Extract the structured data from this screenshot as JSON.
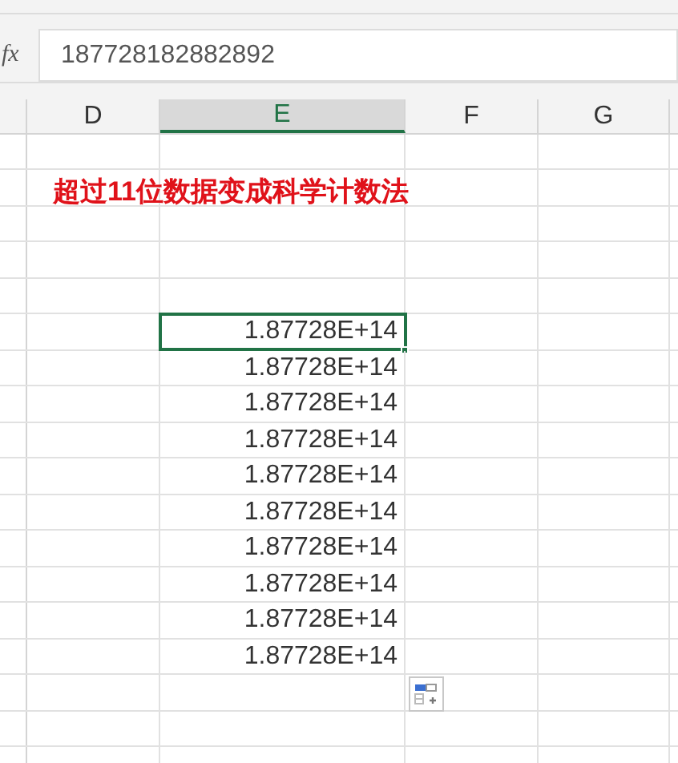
{
  "formula_bar": {
    "function_label": "fx",
    "value": "187728182882892"
  },
  "columns": [
    {
      "label": "D",
      "selected": false
    },
    {
      "label": "E",
      "selected": true
    },
    {
      "label": "F",
      "selected": false
    },
    {
      "label": "G",
      "selected": false
    }
  ],
  "rows": [
    {
      "kind": "empty"
    },
    {
      "kind": "title",
      "text": "超过11位数据变成科学计数法"
    },
    {
      "kind": "empty"
    },
    {
      "kind": "empty"
    },
    {
      "kind": "empty"
    },
    {
      "kind": "value",
      "value": "1.87728E+14",
      "selected": true
    },
    {
      "kind": "value",
      "value": "1.87728E+14",
      "selected": false
    },
    {
      "kind": "value",
      "value": "1.87728E+14",
      "selected": false
    },
    {
      "kind": "value",
      "value": "1.87728E+14",
      "selected": false
    },
    {
      "kind": "value",
      "value": "1.87728E+14",
      "selected": false
    },
    {
      "kind": "value",
      "value": "1.87728E+14",
      "selected": false
    },
    {
      "kind": "value",
      "value": "1.87728E+14",
      "selected": false
    },
    {
      "kind": "value",
      "value": "1.87728E+14",
      "selected": false
    },
    {
      "kind": "value",
      "value": "1.87728E+14",
      "selected": false
    },
    {
      "kind": "value",
      "value": "1.87728E+14",
      "selected": false
    },
    {
      "kind": "paste_options"
    },
    {
      "kind": "empty"
    },
    {
      "kind": "empty"
    }
  ]
}
